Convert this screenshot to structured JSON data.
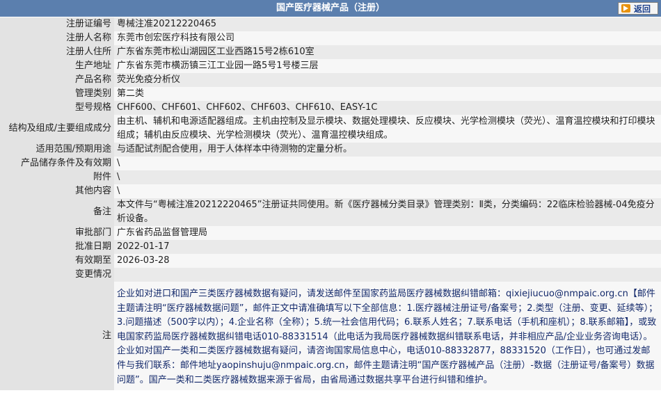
{
  "header": {
    "title": "国产医疗器械产品（注册）",
    "back_label": "返回"
  },
  "rows": [
    {
      "label": "注册证编号",
      "value": "粤械注准20212220465"
    },
    {
      "label": "注册人名称",
      "value": "东莞市创宏医疗科技有限公司"
    },
    {
      "label": "注册人住所",
      "value": "广东省东莞市松山湖园区工业西路15号2栋610室"
    },
    {
      "label": "生产地址",
      "value": "广东省东莞市横沥镇三江工业园一路5号1号楼三层"
    },
    {
      "label": "产品名称",
      "value": "荧光免疫分析仪"
    },
    {
      "label": "管理类别",
      "value": "第二类"
    },
    {
      "label": "型号规格",
      "value": "CHF600、CHF601、CHF602、CHF603、CHF610、EASY-1C"
    },
    {
      "label": "结构及组成/主要组成成分",
      "value": "由主机、辅机和电源适配器组成。主机由控制及显示模块、数据处理模块、反应模块、光学检测模块（荧光）、温育温控模块和打印模块组成；辅机由反应模块、光学检测模块（荧光）、温育温控模块组成。"
    },
    {
      "label": "适用范围/预期用途",
      "value": "与适配试剂配合使用，用于人体样本中待测物的定量分析。"
    },
    {
      "label": "产品储存条件及有效期",
      "value": "\\"
    },
    {
      "label": "附件",
      "value": "\\"
    },
    {
      "label": "其他内容",
      "value": "\\"
    },
    {
      "label": "备注",
      "value": "本文件与“粤械注准20212220465”注册证共同使用。新《医疗器械分类目录》管理类别：Ⅱ类，分类编码：22临床检验器械-04免疫分析设备。"
    },
    {
      "label": "审批部门",
      "value": "广东省药品监督管理局"
    },
    {
      "label": "批准日期",
      "value": "2022-01-17"
    },
    {
      "label": "有效期至",
      "value": "2026-03-28"
    },
    {
      "label": "变更情况",
      "value": ""
    }
  ],
  "note": {
    "label": "注",
    "text": "企业如对进口和国产三类医疗器械数据有疑问，请发送邮件至国家药监局医疗器械数据纠错邮箱：qixiejiucuo@nmpaic.org.cn【邮件主题请注明“医疗器械数据问题”，邮件正文中请准确填写以下全部信息：1.医疗器械注册证号/备案号；2.类型（注册、变更、延续等）；3.问题描述（500字以内）；4.企业名称（全称）；5.统一社会信用代码；6.联系人姓名；7.联系电话（手机和座机）；8.联系邮箱】，或致电国家药监局医疗器械数据纠错电话010-88331514（此电话为我局医疗器械数据纠错联系电话，并非相应产品/企业业务咨询电话）。企业如对国产一类和二类医疗器械数据有疑问，请咨询国家局信息中心，电话010-88332877，88331520（工作日），也可通过发邮件与我们联系：邮件地址yaopinshuju@nmpaic.org.cn，邮件主题请注明“国产医疗器械产品（注册）-数据（注册证号/备案号）数据问题”。国产一类和二类医疗器械数据来源于省局，由省局通过数据共享平台进行纠错和维护。"
  },
  "colors": {
    "header_bg": "#5b7fae",
    "row_odd": "#eaeaea",
    "row_even": "#f7f7f7",
    "note_text": "#13296b"
  },
  "icons": {
    "back": "back-arrow-icon"
  }
}
